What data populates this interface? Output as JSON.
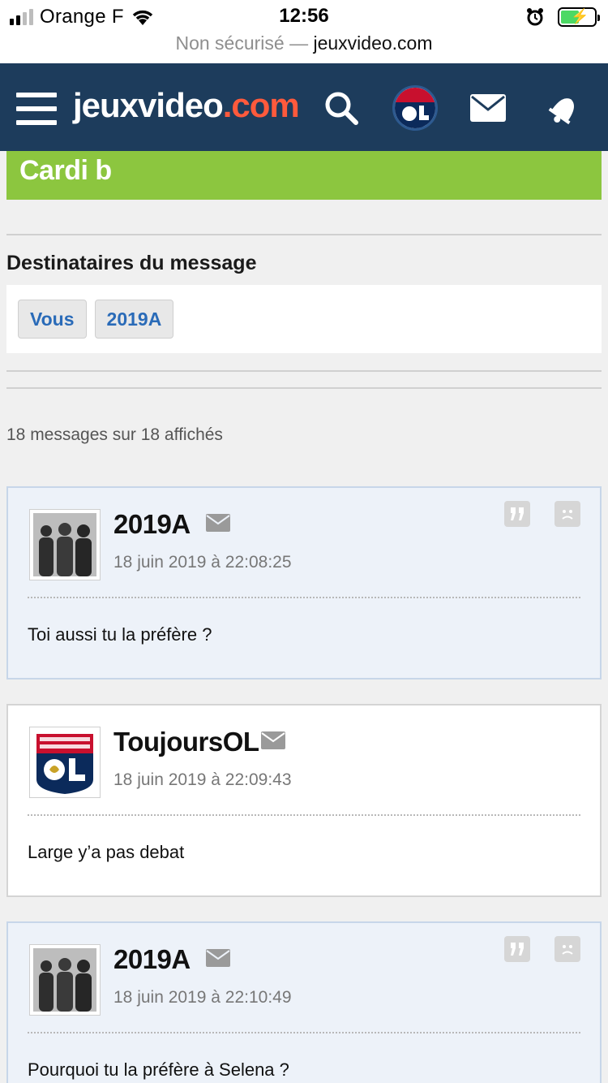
{
  "status": {
    "carrier": "Orange F",
    "time": "12:56",
    "url_prefix": "Non sécurisé — ",
    "url_host": "jeuxvideo.com"
  },
  "header": {
    "logo_main": "jeuxvideo",
    "logo_suffix": ".com",
    "icons": [
      "menu-icon",
      "search-icon",
      "profile-avatar",
      "mail-icon",
      "notification-bell-icon"
    ]
  },
  "topic": {
    "title": "Cardi b"
  },
  "recipients": {
    "heading": "Destinataires du message",
    "tags": [
      "Vous",
      "2019A"
    ]
  },
  "messages_count": "18 messages sur 18 affichés",
  "messages": [
    {
      "author": "2019A",
      "date": "18 juin 2019 à 22:08:25",
      "text": "Toi aussi tu la préfère ?",
      "avatar": "group-photo-avatar"
    },
    {
      "author": "ToujoursOL",
      "date": "18 juin 2019 à 22:09:43",
      "text": "Large y’a pas debat",
      "avatar": "olympique-lyonnais-logo"
    },
    {
      "author": "2019A",
      "date": "18 juin 2019 à 22:10:49",
      "text": "Pourquoi tu la préfère à Selena ?",
      "avatar": "group-photo-avatar"
    }
  ],
  "colors": {
    "header_bg": "#1d3c5c",
    "logo_accent": "#ff5a3c",
    "title_bg": "#8cc63f",
    "tag_text": "#2a6bb8",
    "own_msg_bg": "#edf2f9",
    "own_msg_border": "#c7d6e9"
  }
}
